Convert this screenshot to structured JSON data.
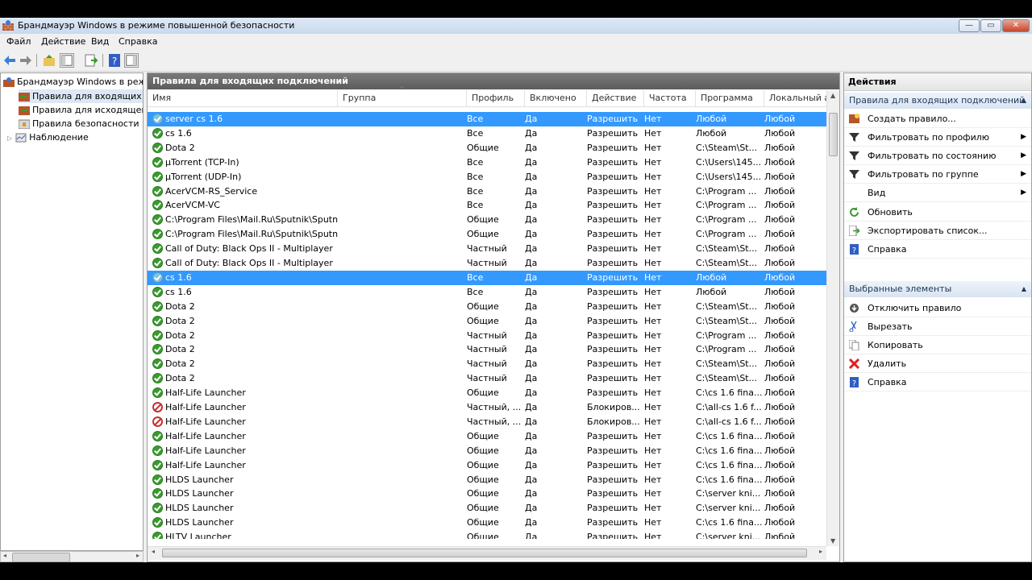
{
  "window": {
    "title": "Брандмауэр Windows в режиме повышенной безопасности",
    "controls": {
      "minimize": "—",
      "maximize": "▭",
      "close": "✕"
    }
  },
  "menu": [
    "Файл",
    "Действие",
    "Вид",
    "Справка"
  ],
  "toolbar": {
    "icons": [
      "back-arrow-icon",
      "forward-arrow-icon",
      "up-folder-icon",
      "show-hide-console-tree-icon",
      "export-list-icon",
      "help-icon",
      "show-hide-action-pane-icon"
    ]
  },
  "tree": {
    "root": "Брандмауэр Windows в режим",
    "items": [
      "Правила для входящих под",
      "Правила для исходящего п",
      "Правила безопасности по",
      "Наблюдение"
    ]
  },
  "center": {
    "header": "Правила для входящих подключений",
    "columns": [
      "Имя",
      "Группа",
      "Профиль",
      "Включено",
      "Действие",
      "Частота",
      "Программа",
      "Локальный ад"
    ],
    "rows": [
      {
        "status": "allow",
        "selected": true,
        "name": "server cs 1.6",
        "group": "",
        "profile": "Все",
        "enabled": "Да",
        "action": "Разрешить",
        "freq": "Нет",
        "program": "Любой",
        "local": "Любой"
      },
      {
        "status": "allow",
        "selected": false,
        "name": "cs 1.6",
        "group": "",
        "profile": "Все",
        "enabled": "Да",
        "action": "Разрешить",
        "freq": "Нет",
        "program": "Любой",
        "local": "Любой"
      },
      {
        "status": "allow",
        "selected": false,
        "name": "Dota 2",
        "group": "",
        "profile": "Общие",
        "enabled": "Да",
        "action": "Разрешить",
        "freq": "Нет",
        "program": "C:\\Steam\\St...",
        "local": "Любой"
      },
      {
        "status": "allow",
        "selected": false,
        "name": "µTorrent (TCP-In)",
        "group": "",
        "profile": "Все",
        "enabled": "Да",
        "action": "Разрешить",
        "freq": "Нет",
        "program": "C:\\Users\\145...",
        "local": "Любой"
      },
      {
        "status": "allow",
        "selected": false,
        "name": "µTorrent (UDP-In)",
        "group": "",
        "profile": "Все",
        "enabled": "Да",
        "action": "Разрешить",
        "freq": "Нет",
        "program": "C:\\Users\\145...",
        "local": "Любой"
      },
      {
        "status": "allow",
        "selected": false,
        "name": "AcerVCM-RS_Service",
        "group": "",
        "profile": "Все",
        "enabled": "Да",
        "action": "Разрешить",
        "freq": "Нет",
        "program": "C:\\Program ...",
        "local": "Любой"
      },
      {
        "status": "allow",
        "selected": false,
        "name": "AcerVCM-VC",
        "group": "",
        "profile": "Все",
        "enabled": "Да",
        "action": "Разрешить",
        "freq": "Нет",
        "program": "C:\\Program ...",
        "local": "Любой"
      },
      {
        "status": "allow",
        "selected": false,
        "name": "C:\\Program Files\\Mail.Ru\\Sputnik\\Sputni...",
        "group": "",
        "profile": "Общие",
        "enabled": "Да",
        "action": "Разрешить",
        "freq": "Нет",
        "program": "C:\\Program ...",
        "local": "Любой"
      },
      {
        "status": "allow",
        "selected": false,
        "name": "C:\\Program Files\\Mail.Ru\\Sputnik\\Sputni...",
        "group": "",
        "profile": "Общие",
        "enabled": "Да",
        "action": "Разрешить",
        "freq": "Нет",
        "program": "C:\\Program ...",
        "local": "Любой"
      },
      {
        "status": "allow",
        "selected": false,
        "name": "Call of Duty: Black Ops II - Multiplayer",
        "group": "",
        "profile": "Частный",
        "enabled": "Да",
        "action": "Разрешить",
        "freq": "Нет",
        "program": "C:\\Steam\\St...",
        "local": "Любой"
      },
      {
        "status": "allow",
        "selected": false,
        "name": "Call of Duty: Black Ops II - Multiplayer",
        "group": "",
        "profile": "Частный",
        "enabled": "Да",
        "action": "Разрешить",
        "freq": "Нет",
        "program": "C:\\Steam\\St...",
        "local": "Любой"
      },
      {
        "status": "allow",
        "selected": true,
        "name": "cs 1.6",
        "group": "",
        "profile": "Все",
        "enabled": "Да",
        "action": "Разрешить",
        "freq": "Нет",
        "program": "Любой",
        "local": "Любой"
      },
      {
        "status": "allow",
        "selected": false,
        "name": "cs 1.6",
        "group": "",
        "profile": "Все",
        "enabled": "Да",
        "action": "Разрешить",
        "freq": "Нет",
        "program": "Любой",
        "local": "Любой"
      },
      {
        "status": "allow",
        "selected": false,
        "name": "Dota 2",
        "group": "",
        "profile": "Общие",
        "enabled": "Да",
        "action": "Разрешить",
        "freq": "Нет",
        "program": "C:\\Steam\\St...",
        "local": "Любой"
      },
      {
        "status": "allow",
        "selected": false,
        "name": "Dota 2",
        "group": "",
        "profile": "Общие",
        "enabled": "Да",
        "action": "Разрешить",
        "freq": "Нет",
        "program": "C:\\Steam\\St...",
        "local": "Любой"
      },
      {
        "status": "allow",
        "selected": false,
        "name": "Dota 2",
        "group": "",
        "profile": "Частный",
        "enabled": "Да",
        "action": "Разрешить",
        "freq": "Нет",
        "program": "C:\\Program ...",
        "local": "Любой"
      },
      {
        "status": "allow",
        "selected": false,
        "name": "Dota 2",
        "group": "",
        "profile": "Частный",
        "enabled": "Да",
        "action": "Разрешить",
        "freq": "Нет",
        "program": "C:\\Program ...",
        "local": "Любой"
      },
      {
        "status": "allow",
        "selected": false,
        "name": "Dota 2",
        "group": "",
        "profile": "Частный",
        "enabled": "Да",
        "action": "Разрешить",
        "freq": "Нет",
        "program": "C:\\Steam\\St...",
        "local": "Любой"
      },
      {
        "status": "allow",
        "selected": false,
        "name": "Dota 2",
        "group": "",
        "profile": "Частный",
        "enabled": "Да",
        "action": "Разрешить",
        "freq": "Нет",
        "program": "C:\\Steam\\St...",
        "local": "Любой"
      },
      {
        "status": "allow",
        "selected": false,
        "name": "Half-Life Launcher",
        "group": "",
        "profile": "Общие",
        "enabled": "Да",
        "action": "Разрешить",
        "freq": "Нет",
        "program": "C:\\cs 1.6 fina...",
        "local": "Любой"
      },
      {
        "status": "block",
        "selected": false,
        "name": "Half-Life Launcher",
        "group": "",
        "profile": "Частный, ...",
        "enabled": "Да",
        "action": "Блокиров...",
        "freq": "Нет",
        "program": "C:\\all-cs 1.6 f...",
        "local": "Любой"
      },
      {
        "status": "block",
        "selected": false,
        "name": "Half-Life Launcher",
        "group": "",
        "profile": "Частный, ...",
        "enabled": "Да",
        "action": "Блокиров...",
        "freq": "Нет",
        "program": "C:\\all-cs 1.6 f...",
        "local": "Любой"
      },
      {
        "status": "allow",
        "selected": false,
        "name": "Half-Life Launcher",
        "group": "",
        "profile": "Общие",
        "enabled": "Да",
        "action": "Разрешить",
        "freq": "Нет",
        "program": "C:\\cs 1.6 fina...",
        "local": "Любой"
      },
      {
        "status": "allow",
        "selected": false,
        "name": "Half-Life Launcher",
        "group": "",
        "profile": "Общие",
        "enabled": "Да",
        "action": "Разрешить",
        "freq": "Нет",
        "program": "C:\\cs 1.6 fina...",
        "local": "Любой"
      },
      {
        "status": "allow",
        "selected": false,
        "name": "Half-Life Launcher",
        "group": "",
        "profile": "Общие",
        "enabled": "Да",
        "action": "Разрешить",
        "freq": "Нет",
        "program": "C:\\cs 1.6 fina...",
        "local": "Любой"
      },
      {
        "status": "allow",
        "selected": false,
        "name": "HLDS Launcher",
        "group": "",
        "profile": "Общие",
        "enabled": "Да",
        "action": "Разрешить",
        "freq": "Нет",
        "program": "C:\\cs 1.6 fina...",
        "local": "Любой"
      },
      {
        "status": "allow",
        "selected": false,
        "name": "HLDS Launcher",
        "group": "",
        "profile": "Общие",
        "enabled": "Да",
        "action": "Разрешить",
        "freq": "Нет",
        "program": "C:\\server kni...",
        "local": "Любой"
      },
      {
        "status": "allow",
        "selected": false,
        "name": "HLDS Launcher",
        "group": "",
        "profile": "Общие",
        "enabled": "Да",
        "action": "Разрешить",
        "freq": "Нет",
        "program": "C:\\server kni...",
        "local": "Любой"
      },
      {
        "status": "allow",
        "selected": false,
        "name": "HLDS Launcher",
        "group": "",
        "profile": "Общие",
        "enabled": "Да",
        "action": "Разрешить",
        "freq": "Нет",
        "program": "C:\\cs 1.6 fina...",
        "local": "Любой"
      },
      {
        "status": "allow",
        "selected": false,
        "name": "HLTV Launcher",
        "group": "",
        "profile": "Общие",
        "enabled": "Да",
        "action": "Разрешить",
        "freq": "Нет",
        "program": "C:\\server kni...",
        "local": "Любой"
      }
    ]
  },
  "actions": {
    "title": "Действия",
    "section1": {
      "header": "Правила для входящих подключений",
      "items": [
        {
          "label": "Создать правило...",
          "icon": "new-rule-icon",
          "submenu": false
        },
        {
          "label": "Фильтровать по профилю",
          "icon": "filter-icon",
          "submenu": true
        },
        {
          "label": "Фильтровать по состоянию",
          "icon": "filter-icon",
          "submenu": true
        },
        {
          "label": "Фильтровать по группе",
          "icon": "filter-icon",
          "submenu": true
        },
        {
          "label": "Вид",
          "icon": "",
          "submenu": true
        },
        {
          "label": "Обновить",
          "icon": "refresh-icon",
          "submenu": false
        },
        {
          "label": "Экспортировать список...",
          "icon": "export-icon",
          "submenu": false
        },
        {
          "label": "Справка",
          "icon": "help-icon",
          "submenu": false
        }
      ]
    },
    "section2": {
      "header": "Выбранные элементы",
      "items": [
        {
          "label": "Отключить правило",
          "icon": "disable-rule-icon",
          "submenu": false
        },
        {
          "label": "Вырезать",
          "icon": "cut-icon",
          "submenu": false
        },
        {
          "label": "Копировать",
          "icon": "copy-icon",
          "submenu": false
        },
        {
          "label": "Удалить",
          "icon": "delete-icon",
          "submenu": false
        },
        {
          "label": "Справка",
          "icon": "help-icon",
          "submenu": false
        }
      ]
    }
  }
}
